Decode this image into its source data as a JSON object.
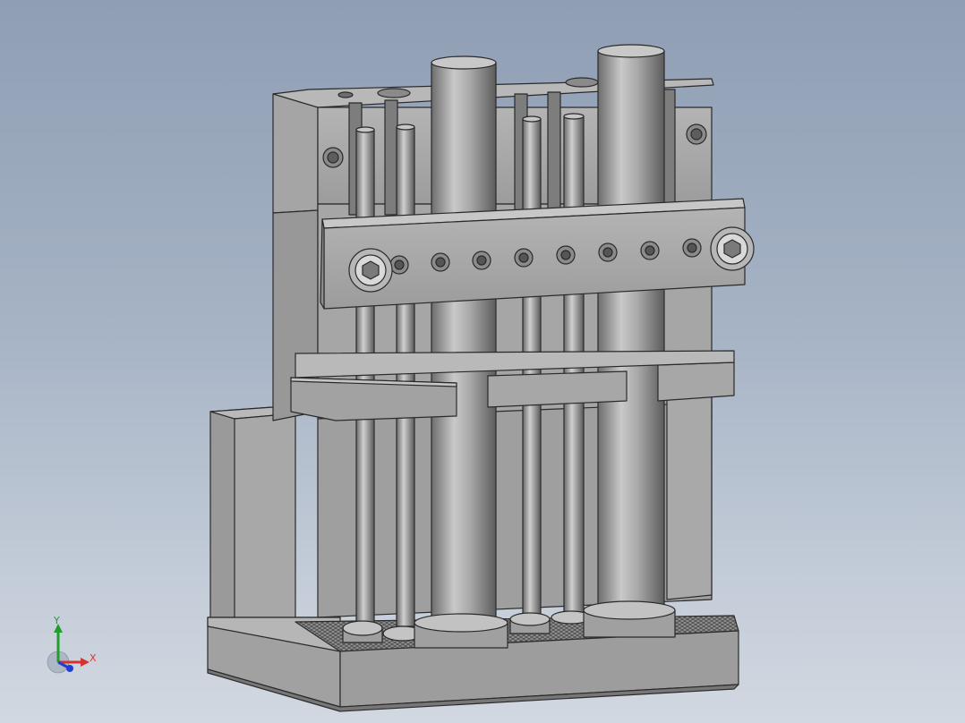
{
  "viewport": {
    "background_top": "#8f9eb4",
    "background_bottom": "#d2d8e1",
    "model_body_color": "#a3a3a3",
    "model_edge_color": "#2a2a2a"
  },
  "triad": {
    "y_label": "Y",
    "x_label": "X",
    "y_color": "#1f9e2a",
    "x_color": "#d33333",
    "z_color": "#1e3fd0"
  }
}
